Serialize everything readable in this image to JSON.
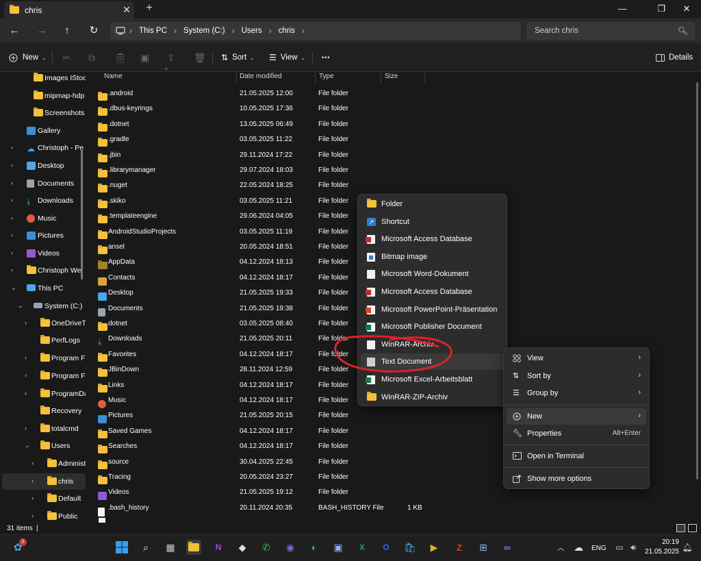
{
  "window": {
    "tab_title": "chris",
    "tab_close": "✕",
    "new_tab": "+",
    "minimize": "—",
    "maximize": "❐",
    "close": "✕"
  },
  "nav_buttons": {
    "back": "←",
    "forward": "→",
    "up": "↑",
    "refresh": "↻"
  },
  "breadcrumb": [
    "This PC",
    "System (C:)",
    "Users",
    "chris"
  ],
  "search": {
    "placeholder": "Search chris"
  },
  "toolbar": {
    "new_label": "New",
    "sort_label": "Sort",
    "view_label": "View",
    "more_label": "•••",
    "details_label": "Details"
  },
  "nav_pane": [
    {
      "label": "Images IStoc",
      "icon": "folder"
    },
    {
      "label": "mipmap-hdp",
      "icon": "folder"
    },
    {
      "label": "Screenshots",
      "icon": "folder"
    },
    {
      "label": "Gallery",
      "icon": "gallery"
    },
    {
      "label": "Christoph - Pe",
      "icon": "cloud"
    },
    {
      "label": "Desktop",
      "icon": "desktop"
    },
    {
      "label": "Documents",
      "icon": "documents"
    },
    {
      "label": "Downloads",
      "icon": "downloads"
    },
    {
      "label": "Music",
      "icon": "music"
    },
    {
      "label": "Pictures",
      "icon": "pictures"
    },
    {
      "label": "Videos",
      "icon": "videos"
    },
    {
      "label": "Christoph Wel",
      "icon": "folder"
    },
    {
      "label": "This PC",
      "icon": "pc"
    },
    {
      "label": "System (C:)",
      "icon": "drive"
    },
    {
      "label": "OneDriveTe",
      "icon": "folder"
    },
    {
      "label": "PerfLogs",
      "icon": "folder"
    },
    {
      "label": "Program Fil",
      "icon": "folder"
    },
    {
      "label": "Program Fil",
      "icon": "folder"
    },
    {
      "label": "ProgramDa",
      "icon": "folder"
    },
    {
      "label": "Recovery",
      "icon": "folder"
    },
    {
      "label": "totalcmd",
      "icon": "folder"
    },
    {
      "label": "Users",
      "icon": "folder"
    },
    {
      "label": "Administr",
      "icon": "folder"
    },
    {
      "label": "chris",
      "icon": "folder"
    },
    {
      "label": "Default",
      "icon": "folder"
    },
    {
      "label": "Public",
      "icon": "folder"
    }
  ],
  "columns": {
    "name": "Name",
    "date": "Date modified",
    "type": "Type",
    "size": "Size"
  },
  "files": [
    {
      "name": ".android",
      "date": "21.05.2025 12:00",
      "type": "File folder",
      "size": ""
    },
    {
      "name": ".dbus-keyrings",
      "date": "10.05.2025 17:36",
      "type": "File folder",
      "size": ""
    },
    {
      "name": ".dotnet",
      "date": "13.05.2025 06:49",
      "type": "File folder",
      "size": ""
    },
    {
      "name": ".gradle",
      "date": "03.05.2025 11:22",
      "type": "File folder",
      "size": ""
    },
    {
      "name": ".jbin",
      "date": "29.11.2024 17:22",
      "type": "File folder",
      "size": ""
    },
    {
      "name": ".librarymanager",
      "date": "29.07.2024 18:03",
      "type": "File folder",
      "size": ""
    },
    {
      "name": ".nuget",
      "date": "22.05.2024 18:25",
      "type": "File folder",
      "size": ""
    },
    {
      "name": ".skiko",
      "date": "03.05.2025 11:21",
      "type": "File folder",
      "size": ""
    },
    {
      "name": ".templateengine",
      "date": "29.06.2024 04:05",
      "type": "File folder",
      "size": ""
    },
    {
      "name": "AndroidStudioProjects",
      "date": "03.05.2025 11:19",
      "type": "File folder",
      "size": ""
    },
    {
      "name": "ansel",
      "date": "20.05.2024 18:51",
      "type": "File folder",
      "size": ""
    },
    {
      "name": "AppData",
      "date": "04.12.2024 18:13",
      "type": "File folder",
      "size": ""
    },
    {
      "name": "Contacts",
      "date": "04.12.2024 18:17",
      "type": "File folder",
      "size": ""
    },
    {
      "name": "Desktop",
      "date": "21.05.2025 19:33",
      "type": "File folder",
      "size": ""
    },
    {
      "name": "Documents",
      "date": "21.05.2025 19:38",
      "type": "File folder",
      "size": ""
    },
    {
      "name": "dotnet",
      "date": "03.05.2025 08:40",
      "type": "File folder",
      "size": ""
    },
    {
      "name": "Downloads",
      "date": "21.05.2025 20:11",
      "type": "File folder",
      "size": ""
    },
    {
      "name": "Favorites",
      "date": "04.12.2024 18:17",
      "type": "File folder",
      "size": ""
    },
    {
      "name": "JBinDown",
      "date": "28.11.2024 12:59",
      "type": "File folder",
      "size": ""
    },
    {
      "name": "Links",
      "date": "04.12.2024 18:17",
      "type": "File folder",
      "size": ""
    },
    {
      "name": "Music",
      "date": "04.12.2024 18:17",
      "type": "File folder",
      "size": ""
    },
    {
      "name": "Pictures",
      "date": "21.05.2025 20:15",
      "type": "File folder",
      "size": ""
    },
    {
      "name": "Saved Games",
      "date": "04.12.2024 18:17",
      "type": "File folder",
      "size": ""
    },
    {
      "name": "Searches",
      "date": "04.12.2024 18:17",
      "type": "File folder",
      "size": ""
    },
    {
      "name": "source",
      "date": "30.04.2025 22:45",
      "type": "File folder",
      "size": ""
    },
    {
      "name": "Tracing",
      "date": "20.05.2024 23:27",
      "type": "File folder",
      "size": ""
    },
    {
      "name": "Videos",
      "date": "21.05.2025 19:12",
      "type": "File folder",
      "size": ""
    },
    {
      "name": ".bash_history",
      "date": "20.11.2024 20:35",
      "type": "BASH_HISTORY File",
      "size": "1 KB"
    }
  ],
  "new_submenu": [
    {
      "label": "Folder",
      "icon": "folder-icon"
    },
    {
      "label": "Shortcut",
      "icon": "shortcut-icon"
    },
    {
      "label": "Microsoft Access Database",
      "icon": "access-icon"
    },
    {
      "label": "Bitmap image",
      "icon": "bitmap-icon"
    },
    {
      "label": "Microsoft Word-Dokument",
      "icon": "word-icon"
    },
    {
      "label": "Microsoft Access Database",
      "icon": "access-icon"
    },
    {
      "label": "Microsoft PowerPoint-Präsentation",
      "icon": "powerpoint-icon"
    },
    {
      "label": "Microsoft Publisher Document",
      "icon": "publisher-icon"
    },
    {
      "label": "WinRAR-Archiv",
      "icon": "winrar-icon"
    },
    {
      "label": "Text Document",
      "icon": "text-document-icon"
    },
    {
      "label": "Microsoft Excel-Arbeitsblatt",
      "icon": "excel-icon"
    },
    {
      "label": "WinRAR-ZIP-Archiv",
      "icon": "zip-icon"
    }
  ],
  "context_menu": {
    "view": "View",
    "sort_by": "Sort by",
    "group_by": "Group by",
    "new": "New",
    "properties": "Properties",
    "properties_accel": "Alt+Enter",
    "open_terminal": "Open in Terminal",
    "show_more": "Show more options"
  },
  "status": {
    "item_count": "31 items",
    "cursor": "|"
  },
  "taskbar": {
    "widgets_badge": "2",
    "language": "ENG",
    "time": "20:19",
    "date": "21.05.2025"
  },
  "colors": {
    "background": "#191919",
    "folder": "#f3c13a",
    "annotation": "#e0202a",
    "menu": "#2c2c2c"
  }
}
